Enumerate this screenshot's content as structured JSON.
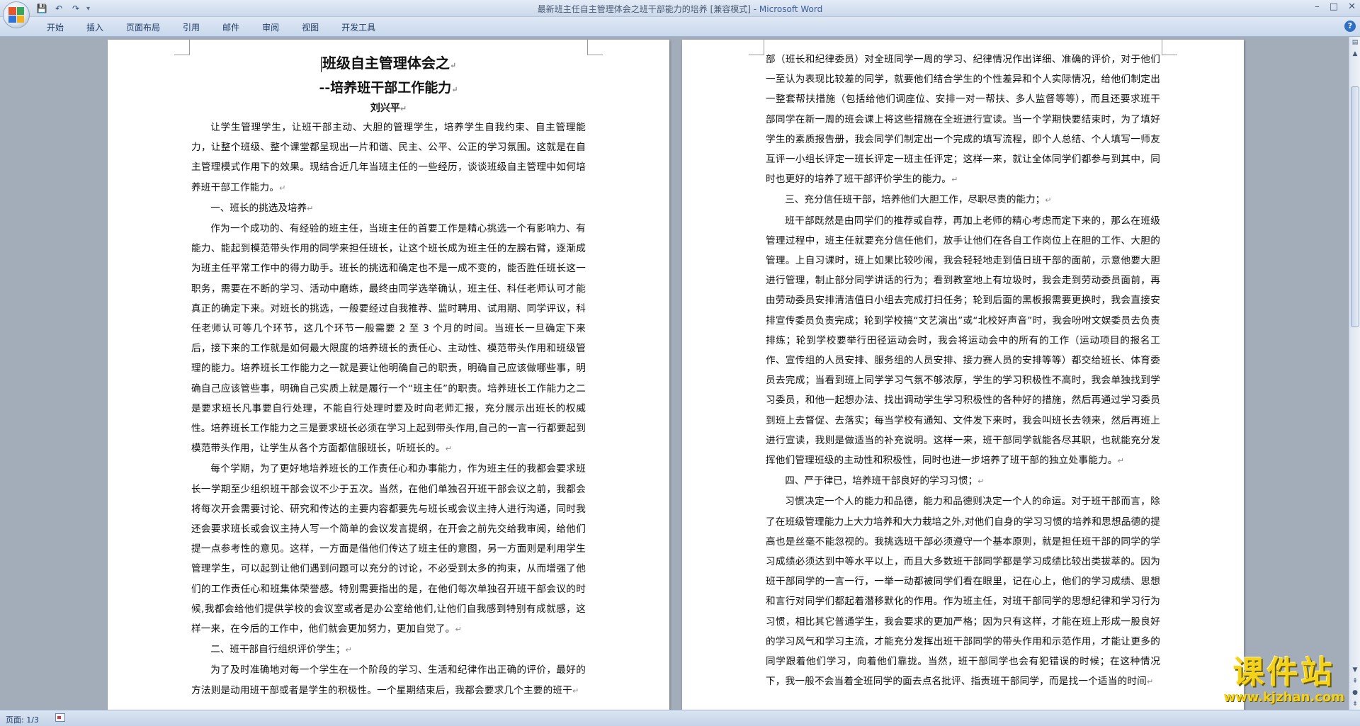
{
  "window": {
    "title": "最新班主任自主管理体会之班干部能力的培养 [兼容模式] - ",
    "app_name": "Microsoft Word",
    "minimize": "–",
    "maximize": "□",
    "close": "✕"
  },
  "quick_access": {
    "save_icon": "save-icon",
    "undo_icon": "undo-icon",
    "redo_icon": "redo-icon",
    "customize_icon": "dropdown-icon"
  },
  "ribbon": {
    "tabs": [
      "开始",
      "插入",
      "页面布局",
      "引用",
      "邮件",
      "审阅",
      "视图",
      "开发工具"
    ],
    "help": "?"
  },
  "page1": {
    "title": "班级自主管理体会之",
    "subtitle": "--培养班干部工作能力",
    "author": "刘兴平",
    "paragraphs": [
      {
        "type": "para",
        "text": "让学生管理学生，让班干部主动、大胆的管理学生，培养学生自我约束、自主管理能力，让整个班级、整个课堂都呈现出一片和谐、民主、公平、公正的学习氛围。这就是在自主管理模式作用下的效果。现结合近几年当班主任的一些经历，谈谈班级自主管理中如何培养班干部工作能力。"
      },
      {
        "type": "heading",
        "text": "一、班长的挑选及培养"
      },
      {
        "type": "para",
        "text": "作为一个成功的、有经验的班主任，当班主任的首要工作是精心挑选一个有影响力、有能力、能起到模范带头作用的同学来担任班长，让这个班长成为班主任的左膀右臂，逐渐成为班主任平常工作中的得力助手。班长的挑选和确定也不是一成不变的，能否胜任班长这一职务，需要在不断的学习、活动中磨练，最终由同学选举确认，班主任、科任老师认可才能真正的确定下来。对班长的挑选，一般要经过自我推荐、监时聘用、试用期、同学评议，科任老师认可等几个环节，这几个环节一般需要 2 至 3 个月的时间。当班长一旦确定下来后，接下来的工作就是如何最大限度的培养班长的责任心、主动性、模范带头作用和班级管理的能力。培养班长工作能力之一就是要让他明确自己的职责，明确自己应该做哪些事，明确自己应该管些事，明确自己实质上就是履行一个“班主任”的职责。培养班长工作能力之二是要求班长凡事要自行处理，不能自行处理时要及时向老师汇报，充分展示出班长的权威性。培养班长工作能力之三是要求班长必须在学习上起到带头作用,自己的一言一行都要起到模范带头作用，让学生从各个方面都信服班长，听班长的。"
      },
      {
        "type": "para",
        "text": "每个学期，为了更好地培养班长的工作责任心和办事能力，作为班主任的我都会要求班长一学期至少组织班干部会议不少于五次。当然，在他们单独召开班干部会议之前，我都会将每次开会需要讨论、研究和传达的主要内容都要先与班长或会议主持人进行沟通，同时我还会要求班长或会议主持人写一个简单的会议发言提纲，在开会之前先交给我审阅，给他们提一点参考性的意见。这样，一方面是借他们传达了班主任的意图，另一方面则是利用学生管理学生，可以起到让他们遇到问题可以充分的讨论，不必受到太多的拘束，从而增强了他们的工作责任心和班集体荣誉感。特别需要指出的是，在他们每次单独召开班干部会议的时候,我都会给他们提供学校的会议室或者是办公室给他们,让他们自我感到特别有成就感，这样一来，在今后的工作中，他们就会更加努力，更加自觉了。"
      },
      {
        "type": "heading",
        "text": "二、班干部自行组织评价学生；"
      },
      {
        "type": "para",
        "text": "为了及时准确地对每一个学生在一个阶段的学习、生活和纪律作出正确的评价，最好的方法则是动用班干部或者是学生的积极性。一个星期结束后，我都会要求几个主要的班干"
      }
    ]
  },
  "page2": {
    "paragraphs": [
      {
        "type": "para-noindent",
        "text": "部（班长和纪律委员）对全班同学一周的学习、纪律情况作出详细、准确的评价，对于他们一至认为表现比较差的同学，就要他们结合学生的个性差异和个人实际情况，给他们制定出一整套帮扶措施（包括给他们调座位、安排一对一帮扶、多人监督等等），而且还要求班干部同学在新一周的班会课上将这些措施在全班进行宣读。当一个学期快要结束时，为了填好学生的素质报告册，我会同学们制定出一个完成的填写流程，即个人总结、个人填写一师友互评一小组长评定一班长评定一班主任评定；这样一来，就让全体同学们都参与到其中，同时也更好的培养了班干部评价学生的能力。"
      },
      {
        "type": "heading",
        "text": "三、充分信任班干部，培养他们大胆工作，尽职尽责的能力；"
      },
      {
        "type": "para",
        "text": "班干部既然是由同学们的推荐或自荐，再加上老师的精心考虑而定下来的，那么在班级管理过程中，班主任就要充分信任他们，放手让他们在各自工作岗位上在胆的工作、大胆的管理。上自习课时，班上如果比较吵闹，我会轻轻地走到值日班干部的面前，示意他要大胆进行管理，制止部分同学讲话的行为；看到教室地上有垃圾时，我会走到劳动委员面前，再由劳动委员安排清洁值日小组去完成打扫任务；轮到后面的黑板报需要更换时，我会直接安排宣传委员负责完成；轮到学校搞“文艺演出”或“北校好声音”时，我会吩咐文娱委员去负责排练；轮到学校要举行田径运动会时，我会将运动会中的所有的工作（运动项目的报名工作、宣传组的人员安排、服务组的人员安排、接力赛人员的安排等等）都交给班长、体育委员去完成；当看到班上同学学习气氛不够浓厚，学生的学习积极性不高时，我会单独找到学习委员，和他一起想办法、找出调动学生学习积极性的各种好的措施，然后再通过学习委员到班上去督促、去落实；每当学校有通知、文件发下来时，我会叫班长去领来，然后再班上进行宣读，我则是做适当的补充说明。这样一来，班干部同学就能各尽其职，也就能充分发挥他们管理班级的主动性和积极性，同时也进一步培养了班干部的独立处事能力。"
      },
      {
        "type": "heading",
        "text": "四、严于律已，培养班干部良好的学习习惯；"
      },
      {
        "type": "para",
        "text": "习惯决定一个人的能力和品德，能力和品德则决定一个人的命运。对于班干部而言，除了在班级管理能力上大力培养和大力栽培之外,对他们自身的学习习惯的培养和思想品德的提高也是丝毫不能忽视的。我挑选班干部必须遵守一个基本原则，就是担任班干部的同学的学习成绩必须达到中等水平以上，而且大多数班干部同学都是学习成绩比较出类拔萃的。因为班干部同学的一言一行，一举一动都被同学们看在眼里，记在心上，他们的学习成绩、思想和言行对同学们都起着潜移默化的作用。作为班主任，对班干部同学的思想纪律和学习行为习惯，相比其它普通学生，我会要求的更加严格；因为只有这样，才能在班上形成一股良好的学习风气和学习主流，才能充分发挥出班干部同学的带头作用和示范作用，才能让更多的同学跟着他们学习，向着他们靠拢。当然，班干部同学也会有犯错误的时候；在这种情况下，我一般不会当着全班同学的面去点名批评、指责班干部同学，而是找一个适当的时间"
      }
    ]
  },
  "status": {
    "page": "页面: 1/3"
  },
  "watermark": {
    "main": "课件站",
    "url": "www.kjzhan.com"
  }
}
